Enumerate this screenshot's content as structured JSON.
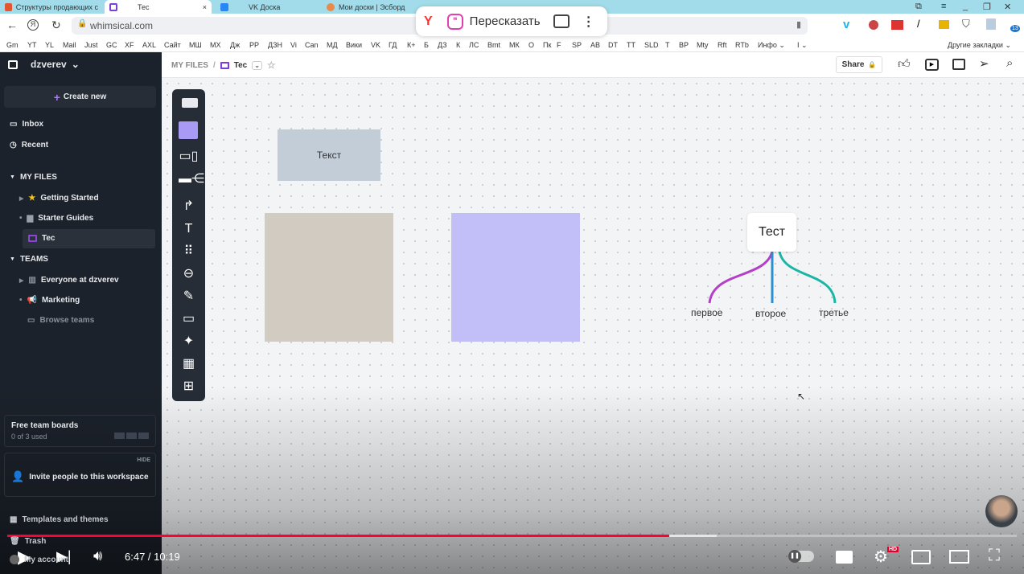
{
  "browser": {
    "tabs": [
      {
        "label": "Структуры продающих с",
        "active": false
      },
      {
        "label": "Тес",
        "active": true
      },
      {
        "label": "VK Доска",
        "active": false
      },
      {
        "label": "Мои доски | Эсборд",
        "active": false
      }
    ],
    "url": "whimsical.com",
    "bookmarks": [
      "Gm",
      "YT",
      "YL",
      "Mail",
      "Just",
      "GC",
      "XF",
      "AXL",
      "Сайт",
      "МШ",
      "МХ",
      "Дж",
      "РР",
      "ДЗН",
      "Vi",
      "Can",
      "МД",
      "Вики",
      "VK",
      "ГД",
      "К+",
      "Б",
      "ДЗ",
      "К",
      "ЛС",
      "Bmt",
      "МК",
      "О",
      "Пк",
      "F",
      "SP",
      "AB",
      "DT",
      "TT",
      "SLD",
      "T",
      "BP",
      "Mty",
      "Rft",
      "RTb",
      "Инфо ⌄",
      "I ⌄"
    ],
    "other_bookmarks": "Другие закладки ⌄",
    "popup_label": "Пересказать",
    "extension_badge": "13"
  },
  "sidebar": {
    "workspace": "dzverev",
    "create_new": "Create new",
    "inbox": "Inbox",
    "recent": "Recent",
    "my_files_header": "MY FILES",
    "my_files": [
      {
        "label": "Getting Started",
        "icon": "star-icon"
      },
      {
        "label": "Starter Guides",
        "icon": "folder-icon"
      },
      {
        "label": "Tec",
        "icon": "board-icon",
        "selected": true
      }
    ],
    "teams_header": "TEAMS",
    "teams": [
      {
        "label": "Everyone at dzverev",
        "icon": "building-icon"
      },
      {
        "label": "Marketing",
        "icon": "megaphone-icon"
      },
      {
        "label": "Browse teams",
        "icon": "box-icon"
      }
    ],
    "free_boards_title": "Free team boards",
    "free_boards_used": "0 of 3 used",
    "invite_hide": "HIDE",
    "invite_label": "Invite people to this workspace",
    "templates": "Templates and themes",
    "trash": "Trash",
    "account": "My account"
  },
  "header": {
    "breadcrumb_root": "MY FILES",
    "separator": "/",
    "board_name": "Tec",
    "share": "Share"
  },
  "canvas": {
    "text_box": "Текст",
    "colors": {
      "text_box": "#c3cdd8",
      "beige": "#d2cbc2",
      "lavender": "#c2bff8"
    },
    "mindmap": {
      "root": "Тест",
      "children": [
        {
          "label": "первое",
          "color": "#b53fc8"
        },
        {
          "label": "второе",
          "color": "#2b8fd0"
        },
        {
          "label": "третье",
          "color": "#1bb5a5"
        }
      ]
    }
  },
  "video": {
    "time": "6:47 / 10:19",
    "progress": 0.656,
    "buffered": 0.703,
    "hd_badge": "HD",
    "accent": "#ff0033"
  }
}
